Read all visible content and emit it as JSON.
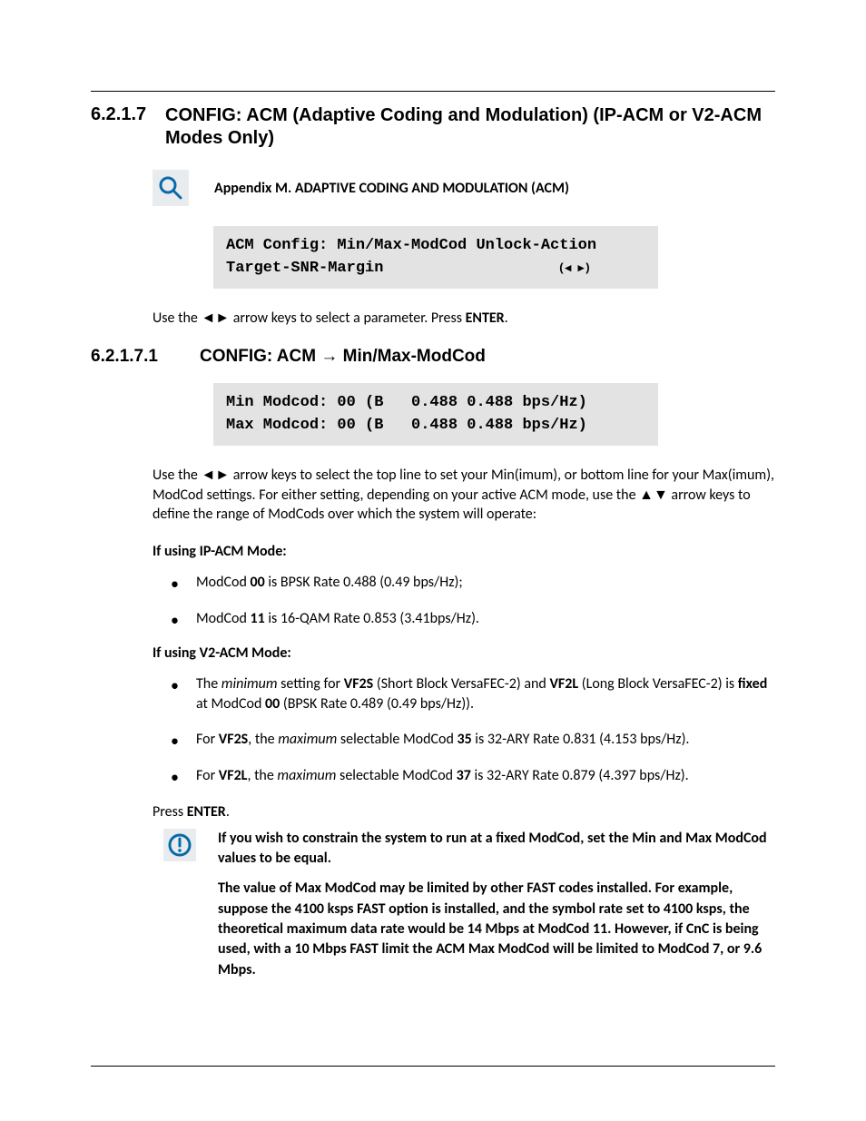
{
  "heading": {
    "number": "6.2.1.7",
    "title": "CONFIG: ACM (Adaptive Coding and Modulation) (IP-ACM or V2-ACM Modes Only)"
  },
  "appendix": "Appendix M. ADAPTIVE CODING AND MODULATION (ACM)",
  "code1": {
    "line1": "ACM Config: Min/Max-ModCod Unlock-Action",
    "line2_left": "Target-SNR-Margin",
    "line2_right": "(◂ ▸)"
  },
  "para1": {
    "pre": "Use the ",
    "arrows": "◄►",
    "post": " arrow keys to select a parameter. Press ",
    "enter": "ENTER",
    "end": "."
  },
  "subheading": {
    "number": "6.2.1.7.1",
    "title_pre": "CONFIG: ACM ",
    "arrow": "→",
    "title_post": " Min/Max-ModCod"
  },
  "code2": {
    "line1": "Min Modcod: 00 (B   0.488 0.488 bps/Hz)",
    "line2": "Max Modcod: 00 (B   0.488 0.488 bps/Hz)"
  },
  "para2": {
    "t1": "Use the ",
    "arrows_lr": "◄►",
    "t2": " arrow keys to select the top line to set your Min(imum), or bottom line for your Max(imum), ModCod settings. For either setting, depending on your active ACM mode, use the ",
    "arrows_ud": "▲▼",
    "t3": " arrow keys to define the range of ModCods over which the system will operate:"
  },
  "ip_label": "If using IP-ACM Mode:",
  "ip_bullets": [
    {
      "pre": "ModCod ",
      "b1": "00",
      "post": " is BPSK Rate 0.488 (0.49 bps/Hz);"
    },
    {
      "pre": "ModCod ",
      "b1": "11",
      "post": " is 16-QAM Rate 0.853 (3.41bps/Hz)."
    }
  ],
  "v2_label": "If using V2-ACM Mode:",
  "v2_bullets": [
    {
      "t1": "The ",
      "i1": "minimum",
      "t2": " setting for ",
      "b1": "VF2S",
      "t3": " (Short Block VersaFEC-2) and ",
      "b2": "VF2L",
      "t4": " (Long Block VersaFEC-2) is ",
      "b3": "fixed",
      "t5": " at ModCod ",
      "b4": "00",
      "t6": " (BPSK Rate 0.489 (0.49 bps/Hz))."
    },
    {
      "t1": "For ",
      "b1": "VF2S",
      "t2": ", the ",
      "i1": "maximum",
      "t3": " selectable ModCod ",
      "b2": "35",
      "t4": " is 32-ARY Rate 0.831 (4.153 bps/Hz)."
    },
    {
      "t1": "For ",
      "b1": "VF2L",
      "t2": ", the ",
      "i1": "maximum",
      "t3": " selectable ModCod ",
      "b2": "37",
      "t4": " is 32-ARY Rate 0.879 (4.397 bps/Hz)."
    }
  ],
  "press_enter": {
    "pre": "Press ",
    "enter": "ENTER",
    "post": "."
  },
  "note1": "If you wish to constrain the system to run at a fixed ModCod, set the Min and Max ModCod values to be equal.",
  "note2": "The value of Max ModCod may be limited by other FAST codes installed. For example, suppose the 4100 ksps FAST option is installed, and the symbol rate set to 4100 ksps, the theoretical maximum data rate would be 14 Mbps at ModCod 11. However, if CnC is being used, with a 10 Mbps FAST limit the ACM Max ModCod will be limited to ModCod 7, or 9.6 Mbps."
}
